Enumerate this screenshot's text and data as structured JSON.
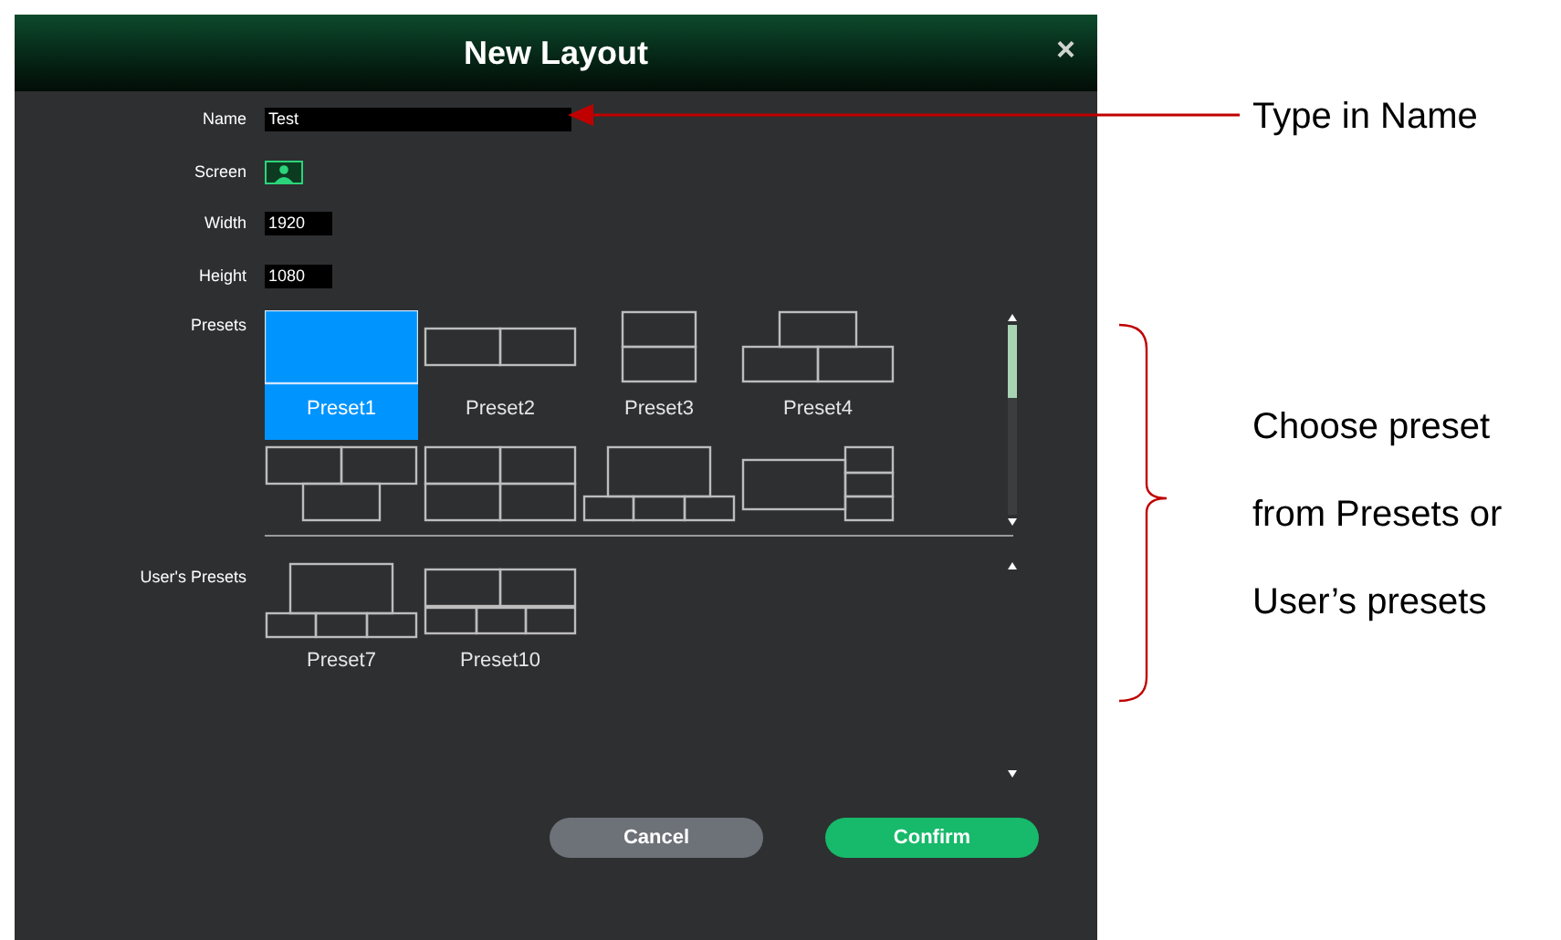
{
  "window": {
    "title": "New Layout",
    "close": "×"
  },
  "fields": [
    {
      "kind": "text",
      "label": "Name",
      "value": "Test"
    },
    {
      "kind": "screen",
      "label": "Screen"
    },
    {
      "kind": "number",
      "label": "Width",
      "value": "1920"
    },
    {
      "kind": "number",
      "label": "Height",
      "value": "1080"
    }
  ],
  "presets": {
    "label": "Presets",
    "items": [
      {
        "label": "Preset1",
        "kind": "single",
        "selected": true
      },
      {
        "label": "Preset2",
        "kind": "columns",
        "selected": false
      },
      {
        "label": "Preset3",
        "kind": "rows",
        "selected": false
      },
      {
        "label": "Preset4",
        "kind": "pyramid",
        "selected": false
      },
      {
        "kind": "inverted",
        "selected": false
      },
      {
        "kind": "quad",
        "selected": false
      },
      {
        "kind": "featured",
        "selected": false
      },
      {
        "kind": "sidebar",
        "selected": false
      }
    ]
  },
  "user_presets": {
    "label": "User's Presets",
    "items": [
      {
        "label": "Preset7",
        "kind": "featured",
        "selected": false
      },
      {
        "label": "Preset10",
        "kind": "mixed",
        "selected": false
      }
    ]
  },
  "buttons": [
    {
      "kind": "cancel",
      "label": "Cancel"
    },
    {
      "kind": "confirm",
      "label": "Confirm"
    }
  ],
  "annotations": [
    {
      "kind": "arrow",
      "text": "Type in Name"
    },
    {
      "kind": "brace",
      "lines": [
        "Choose preset",
        "from Presets or",
        "User’s presets"
      ]
    }
  ]
}
